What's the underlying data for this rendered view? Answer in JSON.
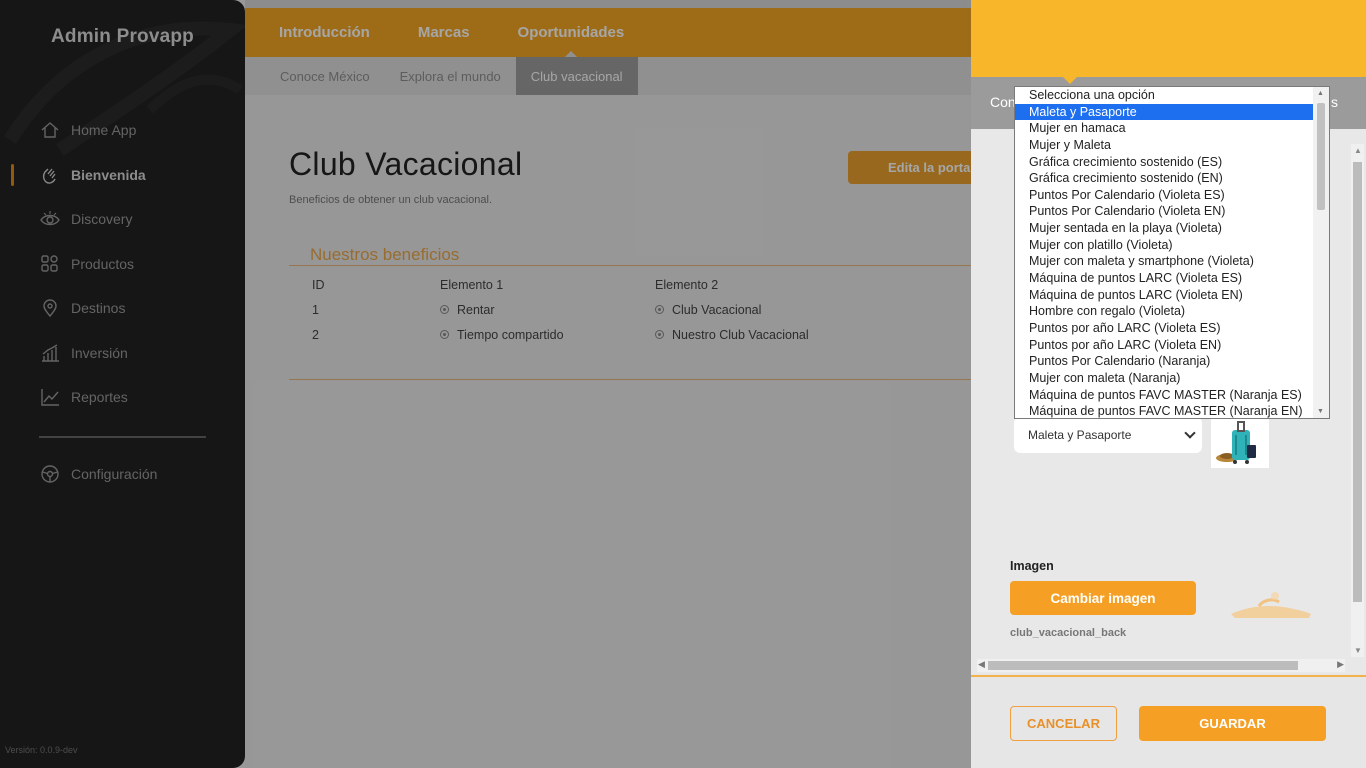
{
  "sidebar": {
    "brand": "Admin Provapp",
    "items": [
      {
        "label": "Home App",
        "icon": "home-icon"
      },
      {
        "label": "Bienvenida",
        "icon": "wave-hand-icon"
      },
      {
        "label": "Discovery",
        "icon": "eye-icon"
      },
      {
        "label": "Productos",
        "icon": "grid-icon"
      },
      {
        "label": "Destinos",
        "icon": "location-pin-icon"
      },
      {
        "label": "Inversión",
        "icon": "bar-chart-icon"
      },
      {
        "label": "Reportes",
        "icon": "line-chart-icon"
      }
    ],
    "settings": {
      "label": "Configuración",
      "icon": "steering-wheel-icon"
    },
    "version": "Versión: 0.0.9-dev",
    "active_item": "Bienvenida",
    "accent_color": "#e08a12"
  },
  "topbar": {
    "tabs": [
      "Introducción",
      "Marcas",
      "Oportunidades"
    ],
    "active_tab": "Oportunidades",
    "color": "#f3a624"
  },
  "subbar": {
    "tabs": [
      "Conoce México",
      "Explora el mundo",
      "Club vacacional"
    ],
    "active_tab": "Club vacacional"
  },
  "page": {
    "title": "Club Vacacional",
    "subtitle": "Beneficios de obtener un club vacacional.",
    "edit_button": "Edita la porta"
  },
  "benefits": {
    "title": "Nuestros beneficios",
    "headers": [
      "ID",
      "Elemento 1",
      "Elemento 2"
    ],
    "rows": [
      [
        "1",
        "Rentar",
        "Club Vacacional"
      ],
      [
        "2",
        "Tiempo compartido",
        "Nuestro Club Vacacional"
      ]
    ]
  },
  "panel": {
    "tab_left": "Con",
    "tab_right": "s",
    "header_color": "#f8b62b",
    "select_value": "Maleta y Pasaporte",
    "image_label": "Imagen",
    "change_image_button": "Cambiar imagen",
    "filename": "club_vacacional_back",
    "cancel_button": "CANCELAR",
    "save_button": "GUARDAR"
  },
  "dropdown": {
    "selected": "Maleta y Pasaporte",
    "selected_color": "#1e6ff0",
    "options": [
      "Selecciona una opción",
      "Maleta y Pasaporte",
      "Mujer en hamaca",
      "Mujer y Maleta",
      "Gráfica crecimiento sostenido (ES)",
      "Gráfica crecimiento sostenido (EN)",
      "Puntos Por Calendario (Violeta ES)",
      "Puntos Por Calendario (Violeta EN)",
      "Mujer sentada en la playa (Violeta)",
      "Mujer con platillo (Violeta)",
      "Mujer con maleta y smartphone (Violeta)",
      "Máquina de puntos LARC (Violeta ES)",
      "Máquina de puntos LARC (Violeta EN)",
      "Hombre con regalo (Violeta)",
      "Puntos por año LARC (Violeta ES)",
      "Puntos por año LARC (Violeta EN)",
      "Puntos Por Calendario (Naranja)",
      "Mujer con maleta (Naranja)",
      "Máquina de puntos FAVC MASTER (Naranja ES)",
      "Máquina de puntos FAVC MASTER (Naranja EN)"
    ]
  }
}
